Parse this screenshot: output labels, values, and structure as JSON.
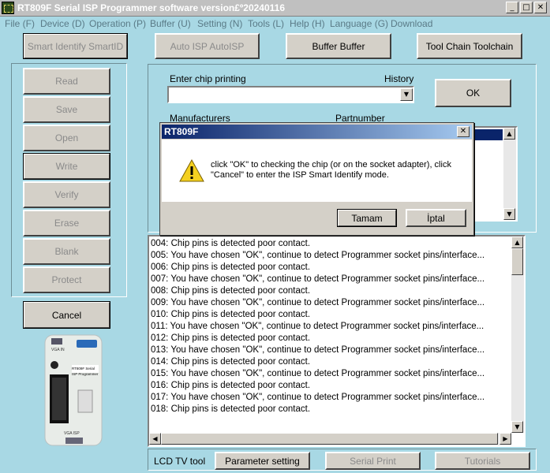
{
  "window": {
    "title": "RT809F Serial ISP Programmer software version£º20240116",
    "minimize": "_",
    "maximize": "□",
    "close": "✕"
  },
  "menu": [
    "File (F)",
    "Device (D)",
    "Operation (P)",
    "Buffer (U)",
    "Setting (N)",
    "Tools (L)",
    "Help (H)",
    "Language (G)",
    "Download"
  ],
  "toolbar": {
    "smart_identify": "Smart Identify SmartID",
    "auto_isp": "Auto ISP AutoISP",
    "buffer": "Buffer Buffer",
    "tool_chain": "Tool Chain Toolchain"
  },
  "side_buttons": {
    "read": "Read",
    "save": "Save",
    "open": "Open",
    "write": "Write",
    "verify": "Verify",
    "erase": "Erase",
    "blank": "Blank",
    "protect": "Protect",
    "cancel": "Cancel"
  },
  "chip": {
    "enter_label": "Enter chip printing",
    "history_label": "History",
    "ok": "OK",
    "manufacturers": "Manufacturers",
    "partnumber": "Partnumber",
    "chip_value": ""
  },
  "log": [
    "004:  Chip pins is detected poor contact.",
    "005:  You have chosen \"OK\", continue to detect Programmer socket pins/interface...",
    "006:  Chip pins is detected poor contact.",
    "007:  You have chosen \"OK\", continue to detect Programmer socket pins/interface...",
    "008:  Chip pins is detected poor contact.",
    "009:  You have chosen \"OK\", continue to detect Programmer socket pins/interface...",
    "010:  Chip pins is detected poor contact.",
    "011:  You have chosen \"OK\", continue to detect Programmer socket pins/interface...",
    "012:  Chip pins is detected poor contact.",
    "013:  You have chosen \"OK\", continue to detect Programmer socket pins/interface...",
    "014:  Chip pins is detected poor contact.",
    "015:  You have chosen \"OK\", continue to detect Programmer socket pins/interface...",
    "016:  Chip pins is detected poor contact.",
    "017:  You have chosen \"OK\", continue to detect Programmer socket pins/interface...",
    "018:  Chip pins is detected poor contact."
  ],
  "bottom": {
    "lcd_tv_tool": "LCD TV tool",
    "parameter_setting": "Parameter setting",
    "serial_print": "Serial Print",
    "tutorials": "Tutorials"
  },
  "dialog": {
    "title": "RT809F",
    "close": "✕",
    "message": "click \"OK\" to checking the chip (or on the socket adapter), click \"Cancel\" to enter the ISP Smart Identify mode.",
    "ok_button": "Tamam",
    "cancel_button": "İptal"
  },
  "device_labels": {
    "vga_in": "VGA IN",
    "model_line1": "RT809F Serial",
    "model_line2": "ISP Programmer",
    "vga_isp": "VGA ISP"
  },
  "colors": {
    "background": "#a8d8e4",
    "button_face": "#d4d0c8",
    "dialog_title_start": "#0a246a",
    "dialog_title_end": "#a6caf0",
    "selection": "#0a246a"
  }
}
